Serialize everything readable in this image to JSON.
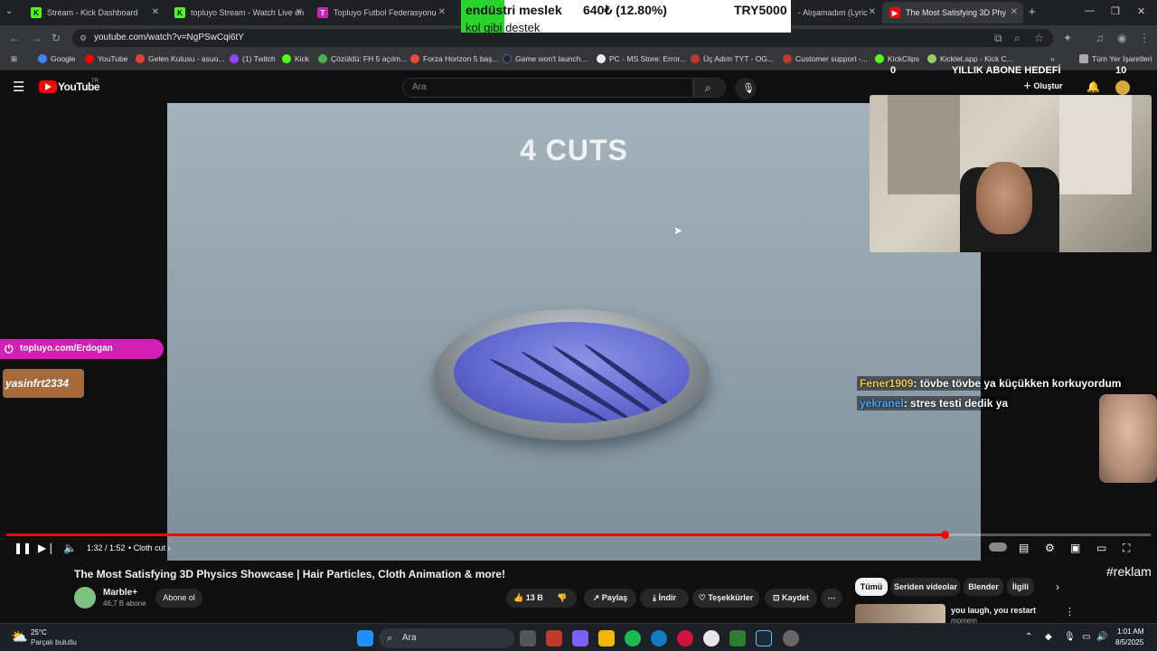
{
  "tabs": [
    {
      "label": "Stream - Kick Dashboard",
      "fav_color": "#53fc18",
      "fav_text": "K"
    },
    {
      "label": "topluyo Stream - Watch Live on",
      "fav_color": "#53fc18",
      "fav_text": "K"
    },
    {
      "label": "Topluyo Futbol Federasyonu",
      "fav_color": "#d21fb4",
      "fav_text": "T"
    },
    {
      "label": "- Alışamadım (Lyric",
      "fav_color": "#ff0000",
      "fav_text": "▶"
    },
    {
      "label": "The Most Satisfying 3D Phy",
      "fav_color": "#ff0000",
      "fav_text": "▶"
    }
  ],
  "address": {
    "url": "youtube.com/watch?v=NgPSwCqi6tY"
  },
  "bookmarks": [
    {
      "label": "Google",
      "color": "#4285f4"
    },
    {
      "label": "YouTube",
      "color": "#ff0000"
    },
    {
      "label": "Gelen Kutusu - asuo...",
      "color": "#ea4335"
    },
    {
      "label": "(1) Twitch",
      "color": "#9146ff"
    },
    {
      "label": "Kick",
      "color": "#53fc18"
    },
    {
      "label": "Çözüldü: FH 5 açılm...",
      "color": "#4caf50"
    },
    {
      "label": "Forza Horizon 5 baş...",
      "color": "#e74c3c"
    },
    {
      "label": "Game won't launch...",
      "color": "#1b2838"
    },
    {
      "label": "PC - MS Store: Error...",
      "color": "#eeeeee"
    },
    {
      "label": "Üç Adım TYT - OG...",
      "color": "#c0392b"
    },
    {
      "label": "Customer support -...",
      "color": "#c0392b"
    },
    {
      "label": "KickClips",
      "color": "#53fc18"
    },
    {
      "label": "Kicklet.app - Kick C...",
      "color": "#9ccc65"
    },
    {
      "label": "Tüm Yer İşaretleri",
      "color": "#aaaaaa"
    }
  ],
  "youtube": {
    "logo": "YouTube",
    "region": "TR",
    "search_placeholder": "Ara",
    "create_label": "Oluştur"
  },
  "video": {
    "overlay_text": "4 CUTS",
    "time": "1:32 / 1:52",
    "chapter": "Cloth cut",
    "progress": 0.82
  },
  "stream_overlay": {
    "alert_line1": "endüstri meslek",
    "alert_amount": "640₺ (12.80%)",
    "alert_goal": "TRY5000",
    "alert_line2": "kol gibi destek",
    "sub_goal_start": "0",
    "sub_goal_label": "YILLIK ABONE HEDEFİ",
    "sub_goal_end": "10",
    "kick_badge": "topluyo.com/Erdogan",
    "sign_text": "yasinfrt2334",
    "chat": [
      {
        "user": "Fener1909",
        "user_color": "#f5c542",
        "text": ": tövbe tövbe ya küçükken korkuyordum"
      },
      {
        "user": "yekranel",
        "user_color": "#3ea6ff",
        "text": ": stres testi dedik ya"
      }
    ]
  },
  "below": {
    "title": "The Most Satisfying 3D Physics Showcase | Hair Particles, Cloth Animation & more!",
    "channel": "Marble+",
    "subscribers": "46,7 B abone",
    "subscribe": "Abone ol",
    "likes": "13 B",
    "share": "Paylaş",
    "download": "İndir",
    "thanks": "Teşekkürler",
    "save": "Kaydet",
    "chips": [
      "Tümü",
      "Seriden videolar",
      "Blender",
      "İlgili"
    ],
    "related_title": "you laugh, you restart",
    "related_channel": "momem",
    "reklam": "#reklam"
  },
  "taskbar": {
    "weather_temp": "25°C",
    "weather_desc": "Parçalı bulutlu",
    "search": "Ara",
    "time": "1:01 AM",
    "date": "8/5/2025"
  }
}
